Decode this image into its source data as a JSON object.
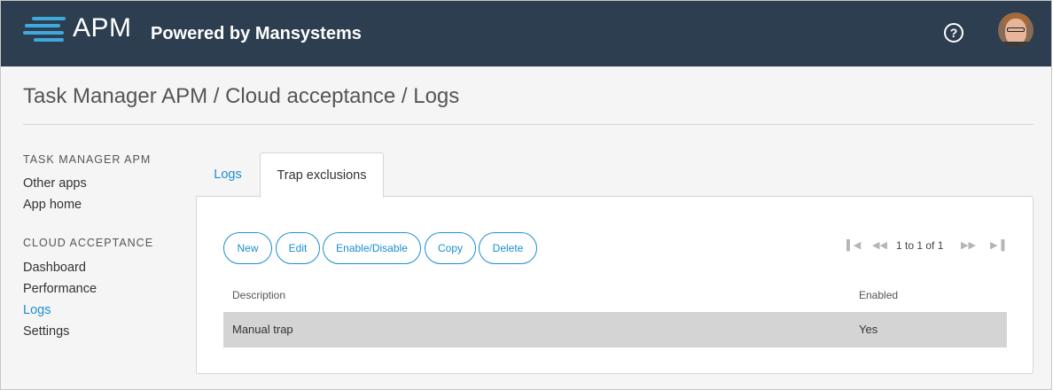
{
  "header": {
    "brand": "APM",
    "powered": "Powered by Mansystems",
    "help_glyph": "?",
    "colors": {
      "bar": "#2d3e50",
      "logo_accent": "#3fa9dd"
    }
  },
  "breadcrumb": "Task Manager APM / Cloud acceptance / Logs",
  "sidebar": {
    "sections": [
      {
        "heading": "TASK MANAGER APM",
        "items": [
          {
            "label": "Other apps"
          },
          {
            "label": "App home"
          }
        ]
      },
      {
        "heading": "CLOUD ACCEPTANCE",
        "items": [
          {
            "label": "Dashboard"
          },
          {
            "label": "Performance"
          },
          {
            "label": "Logs",
            "active": true
          },
          {
            "label": "Settings"
          }
        ]
      }
    ]
  },
  "tabs": [
    {
      "label": "Logs",
      "active": false
    },
    {
      "label": "Trap exclusions",
      "active": true
    }
  ],
  "toolbar": {
    "new": "New",
    "edit": "Edit",
    "enable_disable": "Enable/Disable",
    "copy": "Copy",
    "delete": "Delete"
  },
  "pager": {
    "text": "1 to 1 of 1"
  },
  "table": {
    "columns": [
      "Description",
      "Enabled"
    ],
    "rows": [
      {
        "description": "Manual trap",
        "enabled": "Yes"
      }
    ]
  },
  "colors": {
    "link": "#1a8fd1",
    "selected_row": "#d4d4d4"
  }
}
